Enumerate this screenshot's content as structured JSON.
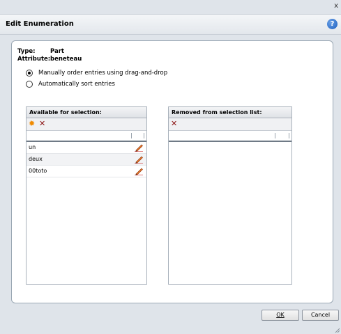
{
  "window": {
    "close_glyph": "x"
  },
  "header": {
    "title": "Edit Enumeration",
    "help_glyph": "?"
  },
  "meta": {
    "type_label": "Type:",
    "type_value": "Part",
    "attribute_label": "Attribute:",
    "attribute_value": "beneteau"
  },
  "options": {
    "manual": {
      "label": "Manually order entries using drag-and-drop",
      "selected": true
    },
    "auto": {
      "label": "Automatically sort entries",
      "selected": false
    }
  },
  "available": {
    "title": "Available for selection:",
    "items": [
      {
        "label": "un"
      },
      {
        "label": "deux"
      },
      {
        "label": "00toto"
      }
    ]
  },
  "removed": {
    "title": "Removed from selection list:",
    "items": []
  },
  "buttons": {
    "ok_label": "OK",
    "cancel_label": "Cancel"
  },
  "icons": {
    "add": "gear-icon",
    "delete": "delete-icon",
    "edit": "pencil-icon",
    "help": "help-icon"
  },
  "colors": {
    "gear": "#f08a00",
    "delete": "#8b1111",
    "help": "#1d5fbf"
  }
}
